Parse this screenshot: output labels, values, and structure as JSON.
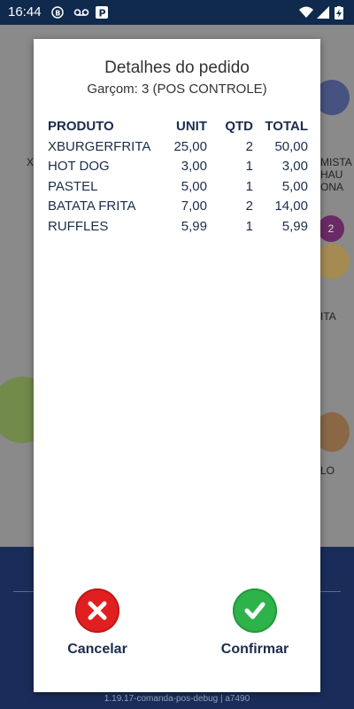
{
  "status_bar": {
    "time": "16:44"
  },
  "dialog": {
    "title": "Detalhes do pedido",
    "subtitle": "Garçom: 3 (POS CONTROLE)",
    "columns": [
      "PRODUTO",
      "UNIT",
      "QTD",
      "TOTAL"
    ],
    "rows": [
      [
        "XBURGERFRITA",
        "25,00",
        "2",
        "50,00"
      ],
      [
        "HOT DOG",
        "3,00",
        "1",
        "3,00"
      ],
      [
        "PASTEL",
        "5,00",
        "1",
        "5,00"
      ],
      [
        "BATATA FRITA",
        "7,00",
        "2",
        "14,00"
      ],
      [
        "RUFFLES",
        "5,99",
        "1",
        "5,99"
      ]
    ],
    "cancel_label": "Cancelar",
    "confirm_label": "Confirmar"
  },
  "background": {
    "badge_count": "2",
    "partial_labels": [
      "X",
      "MISTA",
      "HAU",
      "ONA",
      "ITA",
      "LO"
    ],
    "footer": "1.19.17-comanda-pos-debug | a7490"
  },
  "colors": {
    "cancel": "#e02020",
    "confirm": "#2db34a",
    "status_bar": "#102a4e",
    "text_dark": "#1a2d4d"
  }
}
